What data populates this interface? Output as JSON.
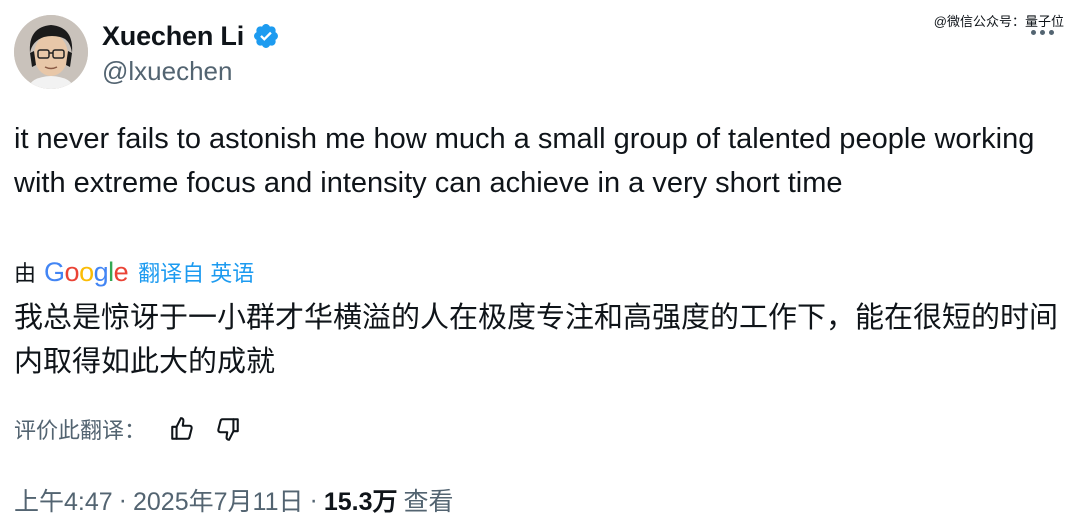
{
  "author": {
    "display_name": "Xuechen Li",
    "handle": "@lxuechen",
    "verified_icon": "verified-badge-icon",
    "verified_color": "#1d9bf0"
  },
  "watermark": "@微信公众号：量子位",
  "tweet": {
    "text": "it never fails to astonish me how much a small group of talented people working with extreme focus and intensity can achieve in a very short time"
  },
  "translation": {
    "by_label": "由",
    "provider_logo": "Google",
    "from_label": "翻译自 英语",
    "text": "我总是惊讶于一小群才华横溢的人在极度专注和高强度的工作下，能在很短的时间内取得如此大的成就",
    "rate_label": "评价此翻译："
  },
  "meta": {
    "time": "上午4:47",
    "date": "2025年7月11日",
    "separator": "·",
    "views_count": "15.3万",
    "views_label": "查看"
  },
  "colors": {
    "text": "#0f1419",
    "secondary": "#536471",
    "link": "#1d9bf0"
  }
}
